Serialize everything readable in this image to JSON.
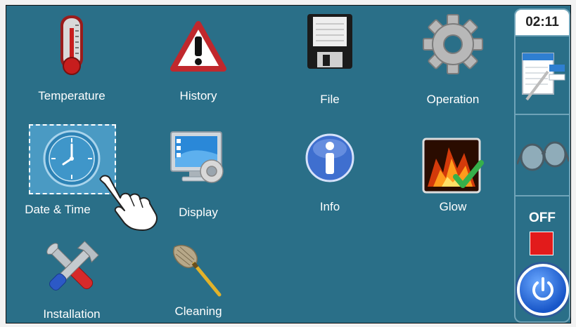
{
  "tiles": {
    "temperature": "Temperature",
    "history": "History",
    "file": "File",
    "operation": "Operation",
    "datetime": "Date & Time",
    "display": "Display",
    "info": "Info",
    "glow": "Glow",
    "installation": "Installation",
    "cleaning": "Cleaning"
  },
  "sidebar": {
    "time": "02:11",
    "state_label": "OFF"
  },
  "icons": {
    "temperature": "thermometer-icon",
    "history": "warning-triangle-icon",
    "file": "floppy-disk-icon",
    "operation": "gear-icon",
    "datetime": "clock-icon",
    "display": "monitor-gear-icon",
    "info": "info-icon",
    "glow": "flame-check-icon",
    "installation": "tools-icon",
    "cleaning": "feather-duster-icon",
    "notes": "notepad-pen-icon",
    "glasses": "glasses-icon",
    "power": "power-icon",
    "hand": "hand-pointer-icon"
  },
  "colors": {
    "background": "#2a6f88",
    "selection": "#4a9ac3",
    "off_indicator": "#e21b1b",
    "power_button": "#1856c8"
  }
}
